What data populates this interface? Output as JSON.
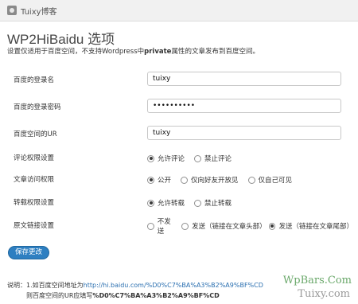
{
  "topbar": {
    "site_name": "Tuixy博客"
  },
  "page": {
    "title": "WP2HiBaidu 选项",
    "desc_before": "设置仅适用于百度空间，不支持Wordpress中",
    "desc_bold": "private",
    "desc_after": "属性的文章发布到百度空间。"
  },
  "fields": {
    "login_name_label": "百度的登录名",
    "login_name_value": "tuixy",
    "password_label": "百度的登录密码",
    "password_value": "••••••••••",
    "space_url_label": "百度空间的UR",
    "space_url_value": "tuixy"
  },
  "comment": {
    "label": "评论权限设置",
    "options": [
      "允许评论",
      "禁止评论"
    ],
    "selected": 0
  },
  "access": {
    "label": "文章访问权限",
    "options": [
      "公开",
      "仅向好友开放见",
      "仅自己可见"
    ],
    "selected": 0
  },
  "repost": {
    "label": "转载权限设置",
    "options": [
      "允许转载",
      "禁止转载"
    ],
    "selected": 0
  },
  "link": {
    "label": "原文链接设置",
    "options": [
      "不发送",
      "发送（链接在文章头部）",
      "发送（链接在文章尾部）"
    ],
    "selected": 2
  },
  "actions": {
    "save_label": "保存更改"
  },
  "footer": {
    "note1_prefix": "说明：1.如百度空间地址为",
    "note1_url": "http://hi.baidu.com/%D0%C7%BA%A3%B2%A9%BF%CD",
    "note2_prefix": "则百度空间的UR应填写",
    "note2_value": "%D0%C7%BA%A3%B2%A9%BF%CD"
  },
  "watermarks": {
    "line1": "WpBars.Com",
    "line2": "Tuixy.com"
  }
}
